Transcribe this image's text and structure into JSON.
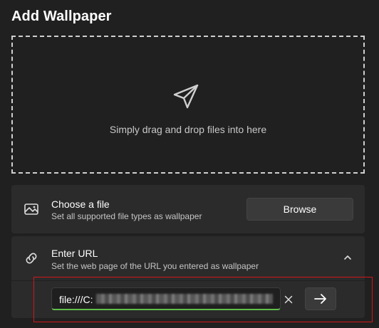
{
  "header": {
    "title": "Add Wallpaper"
  },
  "dropzone": {
    "hint": "Simply drag and drop files into here"
  },
  "choose_file": {
    "title": "Choose a file",
    "subtitle": "Set all supported file types as wallpaper",
    "browse_label": "Browse"
  },
  "enter_url": {
    "title": "Enter URL",
    "subtitle": "Set the web page of the URL you entered as wallpaper",
    "input_value_prefix": "file:///C:"
  },
  "icons": {
    "dropzone": "send-icon",
    "choose_file": "image-icon",
    "enter_url": "link-icon",
    "expand": "chevron-up-icon",
    "clear": "close-icon",
    "submit": "arrow-right-icon"
  },
  "colors": {
    "background": "#202020",
    "card": "#2b2b2b",
    "input_focus_underline": "#5fbf4a",
    "annotation_box": "#d01818"
  }
}
